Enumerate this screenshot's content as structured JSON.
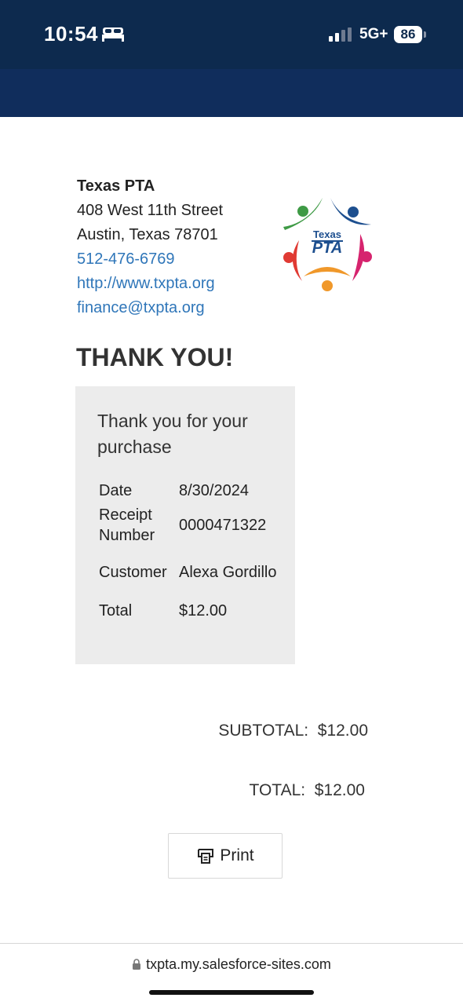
{
  "status_bar": {
    "time": "10:54",
    "network": "5G+",
    "battery": "86",
    "bg_color": "#0d2a4e"
  },
  "organization": {
    "name": "Texas PTA",
    "address_line1": "408 West 11th Street",
    "address_line2": "Austin, Texas 78701",
    "phone": "512-476-6769",
    "website": "http://www.txpta.org",
    "email": "finance@txpta.org",
    "logo": {
      "text_top": "Texas",
      "text_main": "PTA"
    }
  },
  "heading": "THANK YOU!",
  "receipt": {
    "message": "Thank you for your purchase",
    "rows": [
      {
        "label": "Date",
        "value": "8/30/2024"
      },
      {
        "label": "Receipt Number",
        "value": "0000471322"
      },
      {
        "label": "Customer",
        "value": "Alexa Gordillo"
      },
      {
        "label": "Total",
        "value": "$12.00"
      }
    ]
  },
  "totals": {
    "subtotal": "SUBTOTAL:  $12.00",
    "total": "TOTAL:  $12.00"
  },
  "print_button": {
    "label": "Print",
    "icon": "printer-icon"
  },
  "browser": {
    "url": "txpta.my.salesforce-sites.com"
  },
  "colors": {
    "link": "#2f76b9",
    "nav_band": "#102d5c",
    "receipt_box": "#ececec"
  }
}
